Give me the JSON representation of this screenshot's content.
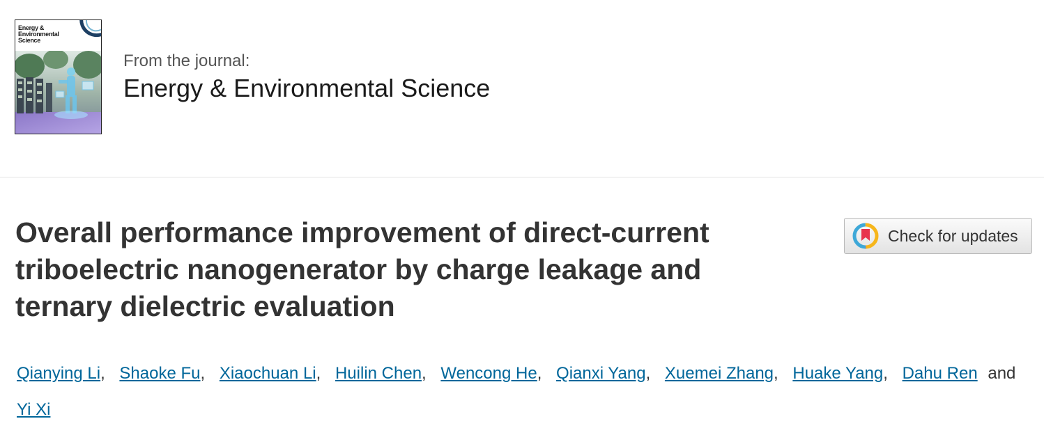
{
  "journal": {
    "cover_title_lines": [
      "Energy &",
      "Environmental",
      "Science"
    ],
    "from_label": "From the journal:",
    "name": "Energy & Environmental Science"
  },
  "article": {
    "title_lines": [
      "Overall performance improvement of direct-current",
      "triboelectric nanogenerator by charge leakage and",
      "ternary dielectric evaluation"
    ]
  },
  "check_updates": {
    "label": "Check for updates",
    "icon": "crossmark-icon"
  },
  "authors": {
    "names": [
      "Qianying Li",
      "Shaoke Fu",
      "Xiaochuan Li",
      "Huilin Chen",
      "Wencong He",
      "Qianxi Yang",
      "Xuemei Zhang",
      "Huake Yang",
      "Dahu Ren",
      "Yi Xi"
    ],
    "separator": ",",
    "conjunction": "and"
  },
  "colors": {
    "link": "#00669a",
    "title": "#333333",
    "divider": "#e2e2e2",
    "crossmark_red": "#e8344e",
    "crossmark_yellow": "#f6b61b",
    "crossmark_blue": "#3ea8d8"
  }
}
